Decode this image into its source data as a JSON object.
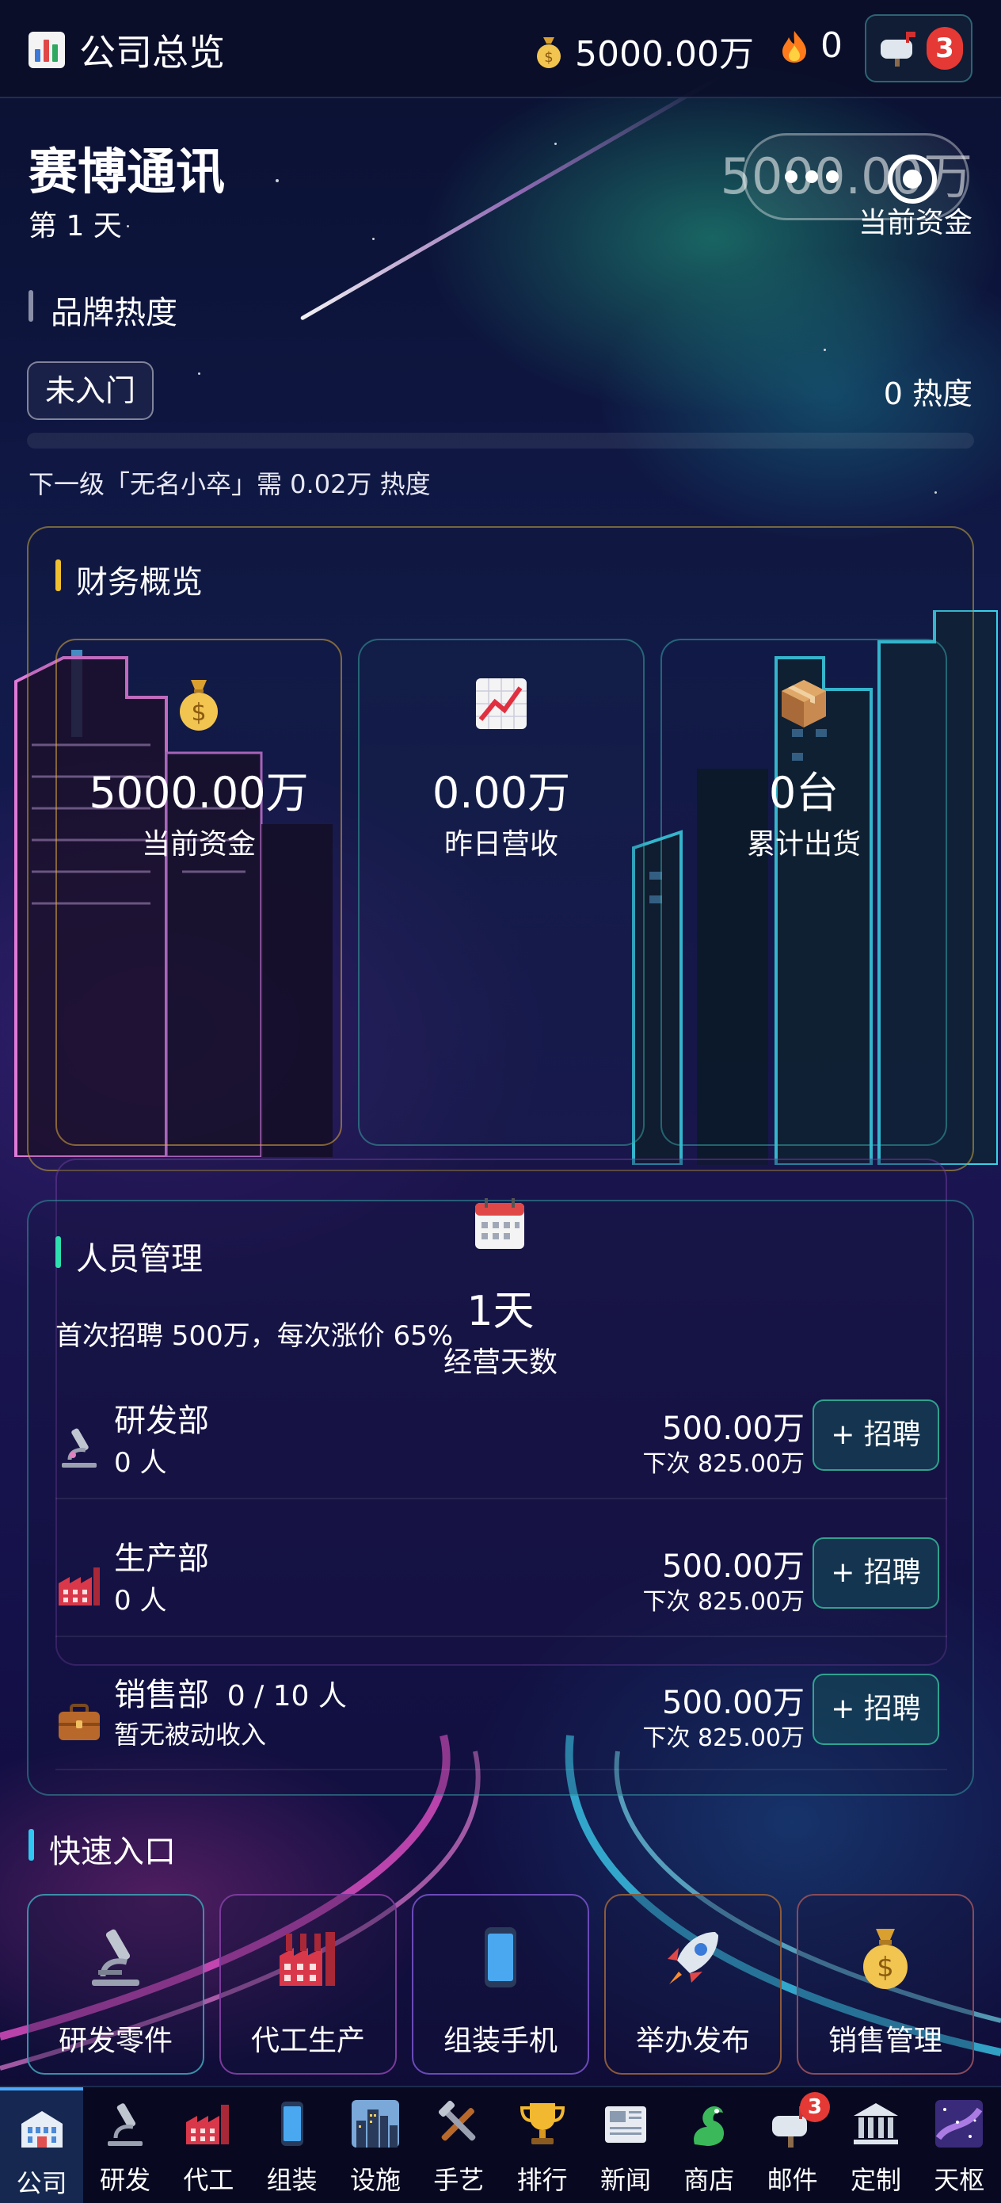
{
  "topbar": {
    "title": "公司总览",
    "money": "5000.00万",
    "heat": "0",
    "mail_badge": "3"
  },
  "company": {
    "name": "赛博通讯",
    "day": "第 1 天",
    "cash": "5000.00万",
    "cash_label": "当前资金"
  },
  "brand": {
    "title": "品牌热度",
    "level": "未入门",
    "heat": "0 热度",
    "progress": 0,
    "next_level": "下一级「无名小卒」需 0.02万 热度"
  },
  "finance": {
    "title": "财务概览",
    "cards": [
      {
        "icon": "money-bag-icon",
        "value": "5000.00万",
        "label": "当前资金"
      },
      {
        "icon": "chart-up-icon",
        "value": "0.00万",
        "label": "昨日营收"
      },
      {
        "icon": "package-icon",
        "value": "0台",
        "label": "累计出货"
      }
    ]
  },
  "operating": {
    "value": "1天",
    "label": "经营天数"
  },
  "staff": {
    "title": "人员管理",
    "hire_note": "首次招聘 500万，每次涨价 65%",
    "departments": [
      {
        "icon": "microscope-icon",
        "name": "研发部",
        "sub": "0 人",
        "cost": "500.00万",
        "next": "下次 825.00万",
        "button": "+ 招聘"
      },
      {
        "icon": "factory-icon",
        "name": "生产部",
        "sub": "0 人",
        "cost": "500.00万",
        "next": "下次 825.00万",
        "button": "+ 招聘"
      },
      {
        "icon": "briefcase-icon",
        "name": "销售部",
        "count": "0 / 10 人",
        "sub": "暂无被动收入",
        "cost": "500.00万",
        "next": "下次 825.00万",
        "button": "+ 招聘"
      }
    ]
  },
  "quick": {
    "title": "快速入口",
    "items": [
      {
        "icon": "microscope-icon",
        "label": "研发零件",
        "border": "#3a8fa8"
      },
      {
        "icon": "factory-icon",
        "label": "代工生产",
        "border": "#7a3a9a"
      },
      {
        "icon": "phone-icon",
        "label": "组装手机",
        "border": "#6a4ab8"
      },
      {
        "icon": "rocket-icon",
        "label": "举办发布",
        "border": "#8a5a3a"
      },
      {
        "icon": "money-bag-icon",
        "label": "销售管理",
        "border": "#8a4a5a"
      }
    ]
  },
  "nav": {
    "items": [
      {
        "icon": "office-building-icon",
        "label": "公司",
        "active": true
      },
      {
        "icon": "microscope-icon",
        "label": "研发"
      },
      {
        "icon": "factory-icon",
        "label": "代工"
      },
      {
        "icon": "phone-icon",
        "label": "组装"
      },
      {
        "icon": "city-icon",
        "label": "设施"
      },
      {
        "icon": "tools-icon",
        "label": "手艺"
      },
      {
        "icon": "trophy-icon",
        "label": "排行"
      },
      {
        "icon": "newspaper-icon",
        "label": "新闻"
      },
      {
        "icon": "dragon-icon",
        "label": "商店"
      },
      {
        "icon": "mailbox-icon",
        "label": "邮件",
        "badge": "3"
      },
      {
        "icon": "bank-icon",
        "label": "定制"
      },
      {
        "icon": "galaxy-icon",
        "label": "天枢"
      }
    ]
  },
  "colors": {
    "accent_gold": "#f0c030",
    "accent_teal": "#2ee0b0",
    "accent_cyan": "#30c8f0",
    "badge_red": "#e53935",
    "background": "#0b0f2e"
  }
}
